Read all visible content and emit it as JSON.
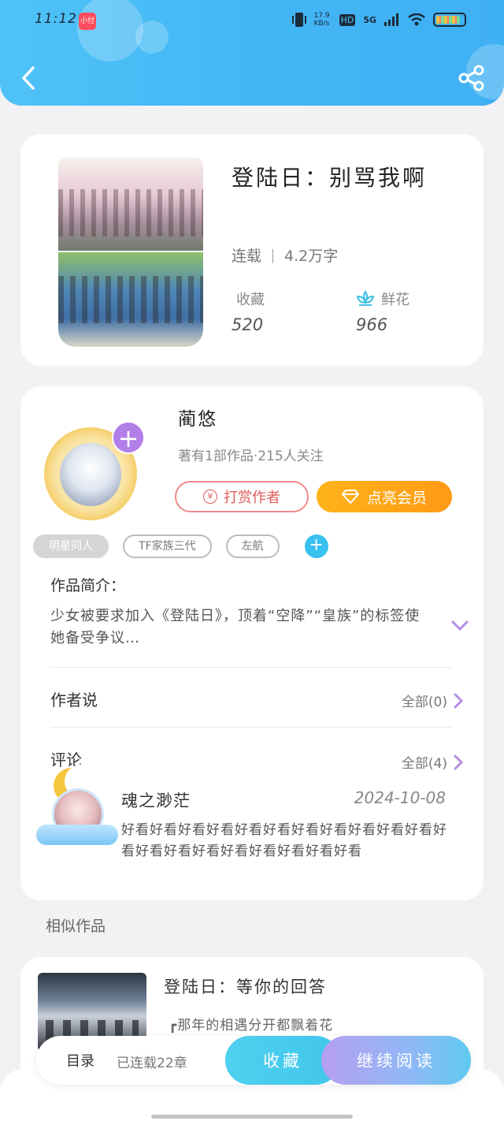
{
  "status_bar": {
    "time": "11:12",
    "app_badge": "小付",
    "net_speed": "17.9 KB/s",
    "hd": "HD",
    "network": "5G"
  },
  "nav": {
    "back_icon": "chevron-left-icon",
    "share_icon": "share-icon"
  },
  "book": {
    "title": "登陆日：别骂我啊",
    "status": "连载",
    "word_count": "4.2万字",
    "favorites_label": "收藏",
    "favorites_value": "520",
    "flowers_label": "鲜花",
    "flowers_value": "966"
  },
  "author": {
    "name": "蔺悠",
    "info": "著有1部作品·215人关注",
    "reward_label": "打赏作者",
    "reward_icon_glyph": "¥",
    "vip_label": "点亮会员",
    "plus_glyph": "+"
  },
  "tags": [
    {
      "label": "明星同人"
    },
    {
      "label": "TF家族三代"
    },
    {
      "label": "左航"
    }
  ],
  "tag_add_glyph": "+",
  "intro": {
    "label": "作品简介：",
    "text": "少女被要求加入《登陆日》，顶着“空降”“皇族”的标签使她备受争议…"
  },
  "author_says": {
    "label": "作者说",
    "count": "全部(0)"
  },
  "comments": {
    "label": "评论",
    "count": "全部(4)",
    "items": [
      {
        "user": "魂之渺茫",
        "date": "2024-10-08",
        "text": "好看好看好看好看好看好看好看好看好看好看好看好看好看好看好看好看好看好看好看好看"
      }
    ]
  },
  "similar": {
    "label": "相似作品",
    "items": [
      {
        "title": "登陆日：等你的回答",
        "desc": "┏那年的相遇分开都飘着花"
      }
    ]
  },
  "bottom_bar": {
    "toc_label": "目录",
    "serial_label": "已连载22章",
    "favorite_button": "收藏",
    "continue_button": "继续阅读"
  },
  "colors": {
    "header": "#43b6f5",
    "vip_orange": "#ff9a16",
    "reward_red": "#e05c5c",
    "accent_purple": "#b27ee8",
    "tag_add_blue": "#38c0ef"
  }
}
